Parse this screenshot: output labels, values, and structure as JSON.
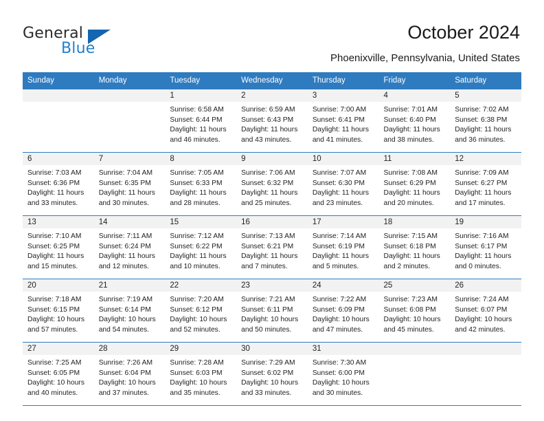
{
  "brand": {
    "name_top": "General",
    "name_bottom": "Blue",
    "accent_color": "#1f7fd0",
    "triangle_color": "#1565b0"
  },
  "header": {
    "title": "October 2024",
    "location": "Phoenixville, Pennsylvania, United States"
  },
  "calendar": {
    "header_bg": "#2f7bc0",
    "daynum_bg": "#f2f2f2",
    "weekday_headers": [
      "Sunday",
      "Monday",
      "Tuesday",
      "Wednesday",
      "Thursday",
      "Friday",
      "Saturday"
    ],
    "labels": {
      "sunrise": "Sunrise:",
      "sunset": "Sunset:",
      "daylight": "Daylight:"
    },
    "weeks": [
      [
        {
          "day": ""
        },
        {
          "day": ""
        },
        {
          "day": "1",
          "sunrise": "Sunrise: 6:58 AM",
          "sunset": "Sunset: 6:44 PM",
          "daylight_line1": "Daylight: 11 hours",
          "daylight_line2": "and 46 minutes."
        },
        {
          "day": "2",
          "sunrise": "Sunrise: 6:59 AM",
          "sunset": "Sunset: 6:43 PM",
          "daylight_line1": "Daylight: 11 hours",
          "daylight_line2": "and 43 minutes."
        },
        {
          "day": "3",
          "sunrise": "Sunrise: 7:00 AM",
          "sunset": "Sunset: 6:41 PM",
          "daylight_line1": "Daylight: 11 hours",
          "daylight_line2": "and 41 minutes."
        },
        {
          "day": "4",
          "sunrise": "Sunrise: 7:01 AM",
          "sunset": "Sunset: 6:40 PM",
          "daylight_line1": "Daylight: 11 hours",
          "daylight_line2": "and 38 minutes."
        },
        {
          "day": "5",
          "sunrise": "Sunrise: 7:02 AM",
          "sunset": "Sunset: 6:38 PM",
          "daylight_line1": "Daylight: 11 hours",
          "daylight_line2": "and 36 minutes."
        }
      ],
      [
        {
          "day": "6",
          "sunrise": "Sunrise: 7:03 AM",
          "sunset": "Sunset: 6:36 PM",
          "daylight_line1": "Daylight: 11 hours",
          "daylight_line2": "and 33 minutes."
        },
        {
          "day": "7",
          "sunrise": "Sunrise: 7:04 AM",
          "sunset": "Sunset: 6:35 PM",
          "daylight_line1": "Daylight: 11 hours",
          "daylight_line2": "and 30 minutes."
        },
        {
          "day": "8",
          "sunrise": "Sunrise: 7:05 AM",
          "sunset": "Sunset: 6:33 PM",
          "daylight_line1": "Daylight: 11 hours",
          "daylight_line2": "and 28 minutes."
        },
        {
          "day": "9",
          "sunrise": "Sunrise: 7:06 AM",
          "sunset": "Sunset: 6:32 PM",
          "daylight_line1": "Daylight: 11 hours",
          "daylight_line2": "and 25 minutes."
        },
        {
          "day": "10",
          "sunrise": "Sunrise: 7:07 AM",
          "sunset": "Sunset: 6:30 PM",
          "daylight_line1": "Daylight: 11 hours",
          "daylight_line2": "and 23 minutes."
        },
        {
          "day": "11",
          "sunrise": "Sunrise: 7:08 AM",
          "sunset": "Sunset: 6:29 PM",
          "daylight_line1": "Daylight: 11 hours",
          "daylight_line2": "and 20 minutes."
        },
        {
          "day": "12",
          "sunrise": "Sunrise: 7:09 AM",
          "sunset": "Sunset: 6:27 PM",
          "daylight_line1": "Daylight: 11 hours",
          "daylight_line2": "and 17 minutes."
        }
      ],
      [
        {
          "day": "13",
          "sunrise": "Sunrise: 7:10 AM",
          "sunset": "Sunset: 6:25 PM",
          "daylight_line1": "Daylight: 11 hours",
          "daylight_line2": "and 15 minutes."
        },
        {
          "day": "14",
          "sunrise": "Sunrise: 7:11 AM",
          "sunset": "Sunset: 6:24 PM",
          "daylight_line1": "Daylight: 11 hours",
          "daylight_line2": "and 12 minutes."
        },
        {
          "day": "15",
          "sunrise": "Sunrise: 7:12 AM",
          "sunset": "Sunset: 6:22 PM",
          "daylight_line1": "Daylight: 11 hours",
          "daylight_line2": "and 10 minutes."
        },
        {
          "day": "16",
          "sunrise": "Sunrise: 7:13 AM",
          "sunset": "Sunset: 6:21 PM",
          "daylight_line1": "Daylight: 11 hours",
          "daylight_line2": "and 7 minutes."
        },
        {
          "day": "17",
          "sunrise": "Sunrise: 7:14 AM",
          "sunset": "Sunset: 6:19 PM",
          "daylight_line1": "Daylight: 11 hours",
          "daylight_line2": "and 5 minutes."
        },
        {
          "day": "18",
          "sunrise": "Sunrise: 7:15 AM",
          "sunset": "Sunset: 6:18 PM",
          "daylight_line1": "Daylight: 11 hours",
          "daylight_line2": "and 2 minutes."
        },
        {
          "day": "19",
          "sunrise": "Sunrise: 7:16 AM",
          "sunset": "Sunset: 6:17 PM",
          "daylight_line1": "Daylight: 11 hours",
          "daylight_line2": "and 0 minutes."
        }
      ],
      [
        {
          "day": "20",
          "sunrise": "Sunrise: 7:18 AM",
          "sunset": "Sunset: 6:15 PM",
          "daylight_line1": "Daylight: 10 hours",
          "daylight_line2": "and 57 minutes."
        },
        {
          "day": "21",
          "sunrise": "Sunrise: 7:19 AM",
          "sunset": "Sunset: 6:14 PM",
          "daylight_line1": "Daylight: 10 hours",
          "daylight_line2": "and 54 minutes."
        },
        {
          "day": "22",
          "sunrise": "Sunrise: 7:20 AM",
          "sunset": "Sunset: 6:12 PM",
          "daylight_line1": "Daylight: 10 hours",
          "daylight_line2": "and 52 minutes."
        },
        {
          "day": "23",
          "sunrise": "Sunrise: 7:21 AM",
          "sunset": "Sunset: 6:11 PM",
          "daylight_line1": "Daylight: 10 hours",
          "daylight_line2": "and 50 minutes."
        },
        {
          "day": "24",
          "sunrise": "Sunrise: 7:22 AM",
          "sunset": "Sunset: 6:09 PM",
          "daylight_line1": "Daylight: 10 hours",
          "daylight_line2": "and 47 minutes."
        },
        {
          "day": "25",
          "sunrise": "Sunrise: 7:23 AM",
          "sunset": "Sunset: 6:08 PM",
          "daylight_line1": "Daylight: 10 hours",
          "daylight_line2": "and 45 minutes."
        },
        {
          "day": "26",
          "sunrise": "Sunrise: 7:24 AM",
          "sunset": "Sunset: 6:07 PM",
          "daylight_line1": "Daylight: 10 hours",
          "daylight_line2": "and 42 minutes."
        }
      ],
      [
        {
          "day": "27",
          "sunrise": "Sunrise: 7:25 AM",
          "sunset": "Sunset: 6:05 PM",
          "daylight_line1": "Daylight: 10 hours",
          "daylight_line2": "and 40 minutes."
        },
        {
          "day": "28",
          "sunrise": "Sunrise: 7:26 AM",
          "sunset": "Sunset: 6:04 PM",
          "daylight_line1": "Daylight: 10 hours",
          "daylight_line2": "and 37 minutes."
        },
        {
          "day": "29",
          "sunrise": "Sunrise: 7:28 AM",
          "sunset": "Sunset: 6:03 PM",
          "daylight_line1": "Daylight: 10 hours",
          "daylight_line2": "and 35 minutes."
        },
        {
          "day": "30",
          "sunrise": "Sunrise: 7:29 AM",
          "sunset": "Sunset: 6:02 PM",
          "daylight_line1": "Daylight: 10 hours",
          "daylight_line2": "and 33 minutes."
        },
        {
          "day": "31",
          "sunrise": "Sunrise: 7:30 AM",
          "sunset": "Sunset: 6:00 PM",
          "daylight_line1": "Daylight: 10 hours",
          "daylight_line2": "and 30 minutes."
        },
        {
          "day": ""
        },
        {
          "day": ""
        }
      ]
    ]
  }
}
